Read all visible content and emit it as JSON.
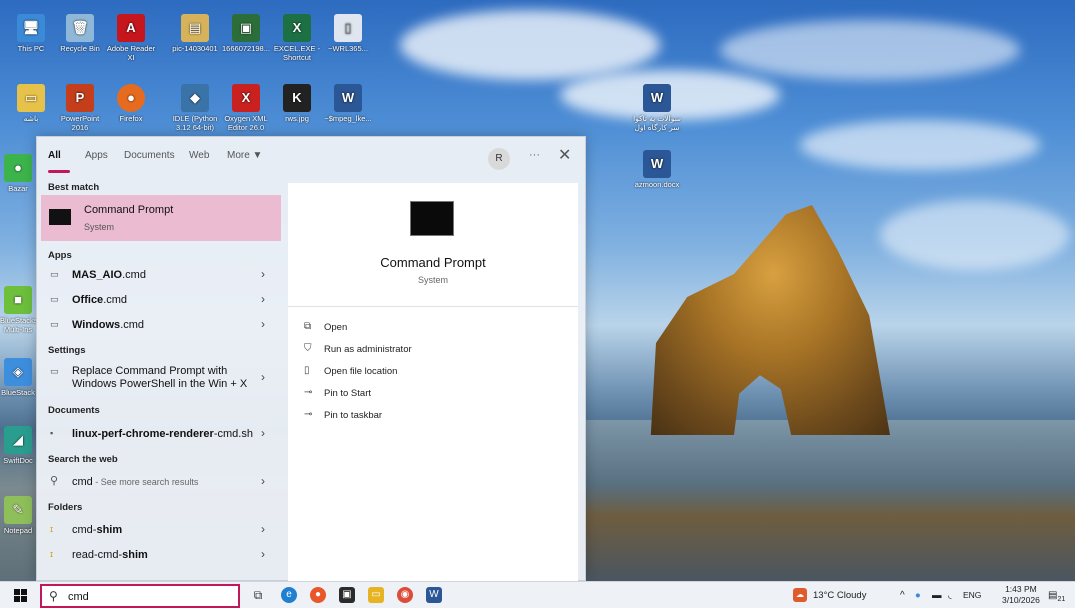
{
  "desktop": {
    "icons": [
      {
        "label": "This PC"
      },
      {
        "label": "Recycle Bin"
      },
      {
        "label": "Adobe Reader XI"
      },
      {
        "label": "pic-14030401"
      },
      {
        "label": "1666072198..."
      },
      {
        "label": "EXCEL.EXE - Shortcut"
      },
      {
        "label": "~WRL365..."
      },
      {
        "label": "باشه"
      },
      {
        "label": "PowerPoint 2016"
      },
      {
        "label": "Firefox"
      },
      {
        "label": "IDLE (Python 3.12 64-bit)"
      },
      {
        "label": "Oxygen XML Editor 26.0"
      },
      {
        "label": "rws.jpg"
      },
      {
        "label": "~$mpeg_lke..."
      },
      {
        "label": "سوالات یه تاکوا سر کارگاه اول"
      },
      {
        "label": "azmoon.docx"
      },
      {
        "label": "Bazar"
      },
      {
        "label": "BlueStacks Multi-Ins"
      },
      {
        "label": "BlueStack"
      },
      {
        "label": "SwiftDoc"
      },
      {
        "label": "Notepad"
      }
    ]
  },
  "search_panel": {
    "tabs": [
      "All",
      "Apps",
      "Documents",
      "Web",
      "More ▼"
    ],
    "avatar_initial": "R",
    "dots": "···",
    "close": "✕",
    "best_match": {
      "heading": "Best match",
      "title": "Command Prompt",
      "subtitle": "System"
    },
    "apps": {
      "heading": "Apps",
      "items": [
        {
          "bold": "MAS_AIO",
          "rest": ".cmd"
        },
        {
          "bold": "Office",
          "rest": ".cmd"
        },
        {
          "bold": "Windows",
          "rest": ".cmd"
        }
      ]
    },
    "settings": {
      "heading": "Settings",
      "line1": "Replace Command Prompt with",
      "line2": "Windows PowerShell in the Win + X"
    },
    "documents": {
      "heading": "Documents",
      "item_bold": "linux-perf-chrome-renderer",
      "item_rest": "-cmd.sh"
    },
    "web": {
      "heading": "Search the web",
      "query": "cmd",
      "hint": " - See more search results"
    },
    "folders": {
      "heading": "Folders",
      "items": [
        {
          "prefix": "cmd-",
          "bold": "shim"
        },
        {
          "prefix": "read-cmd-",
          "bold": "shim"
        }
      ]
    },
    "preview": {
      "title": "Command Prompt",
      "subtitle": "System",
      "actions": [
        "Open",
        "Run as administrator",
        "Open file location",
        "Pin to Start",
        "Pin to taskbar"
      ]
    }
  },
  "taskbar": {
    "search_value": "cmd",
    "weather": "13°C  Cloudy",
    "lang": "ENG",
    "time": "1:43 PM",
    "date": "3/10/2026",
    "notif_count": "21"
  }
}
